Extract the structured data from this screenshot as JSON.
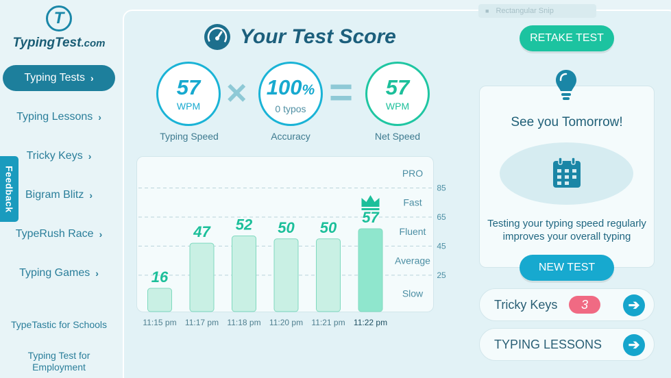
{
  "brand": {
    "mark": "T",
    "name": "TypingTest",
    "tld": ".com"
  },
  "feedback_label": "Feedback",
  "sidebar": {
    "items": [
      {
        "label": "Typing Tests",
        "active": true
      },
      {
        "label": "Typing Lessons",
        "active": false
      },
      {
        "label": "Tricky Keys",
        "active": false
      },
      {
        "label": "Bigram Blitz",
        "active": false
      },
      {
        "label": "TypeRush Race",
        "active": false
      },
      {
        "label": "Typing Games",
        "active": false
      }
    ],
    "chevron": "›",
    "footer_links": [
      "TypeTastic for Schools",
      "Typing Test for Employment"
    ]
  },
  "overlay": {
    "snip_label": "Rectangular Snip"
  },
  "header": {
    "title": "Your Test Score",
    "icon": "speedometer-icon"
  },
  "score": {
    "typing_speed": {
      "value": "57",
      "unit": "WPM",
      "label": "Typing Speed"
    },
    "operator_multiply": "×",
    "accuracy": {
      "value": "100",
      "suffix": "%",
      "unit": "0 typos",
      "label": "Accuracy"
    },
    "operator_equals": "=",
    "net_speed": {
      "value": "57",
      "unit": "WPM",
      "label": "Net Speed"
    }
  },
  "chart_data": {
    "type": "bar",
    "categories": [
      "11:15 pm",
      "11:17 pm",
      "11:18 pm",
      "11:20 pm",
      "11:21 pm",
      "11:22 pm"
    ],
    "values": [
      16,
      47,
      52,
      50,
      50,
      57
    ],
    "data_labels": [
      "16",
      "47",
      "52",
      "50",
      "50",
      "57"
    ],
    "highlight_index": 5,
    "highlight_icon": "crown-icon",
    "ylim": [
      0,
      105
    ],
    "y_ticks": [
      25,
      45,
      65,
      85
    ],
    "y_tick_labels": [
      "25",
      "45",
      "65",
      "85"
    ],
    "bands": [
      "PRO",
      "Fast",
      "Fluent",
      "Average",
      "Slow"
    ],
    "colors": {
      "bar": "#c9f0e4",
      "bar_border": "#7fd9bf",
      "bar_highlight": "#8fe6cd",
      "label": "#1cbf9a"
    },
    "grid": true
  },
  "actions": {
    "retake": "RETAKE TEST",
    "new_test": "NEW TEST"
  },
  "tip": {
    "icon": "lightbulb-icon",
    "title": "See you Tomorrow!",
    "calendar_icon": "calendar-icon",
    "text": "Testing your typing speed regularly improves your overall typing"
  },
  "links": {
    "tricky_keys": {
      "label": "Tricky Keys",
      "badge": "3"
    },
    "typing_lessons": {
      "label": "TYPING LESSONS"
    }
  },
  "colors": {
    "accent_blue": "#17a9cf",
    "accent_green": "#1cc3a0",
    "nav_active": "#1d7f9c",
    "badge": "#f06a83"
  }
}
